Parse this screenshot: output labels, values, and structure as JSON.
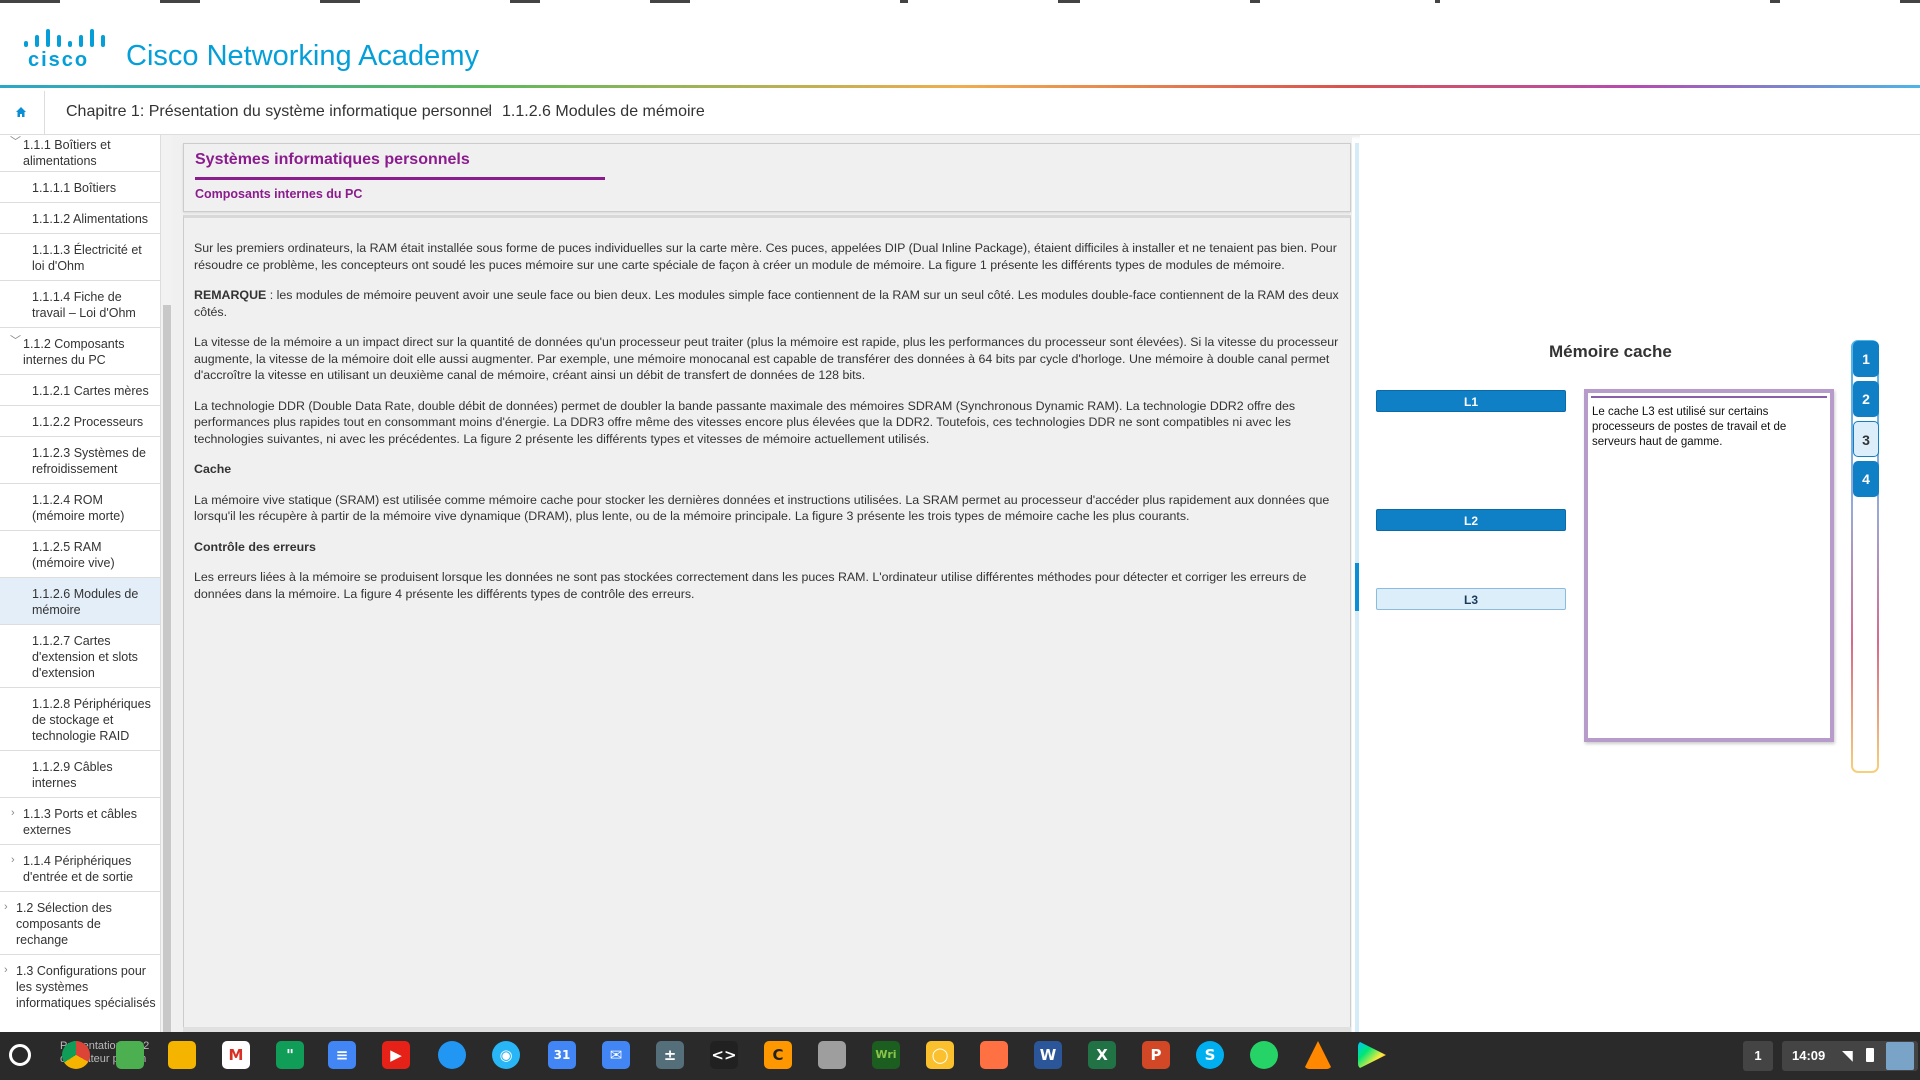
{
  "header": {
    "logo_text": "cisco",
    "brand": "Cisco Networking Academy"
  },
  "breadcrumb": {
    "chapter": "Chapitre 1: Présentation du système informatique personnel",
    "separator": "›",
    "current": "1.1.2.6 Modules de mémoire"
  },
  "sidebar": {
    "items": [
      {
        "label": "1.1.1 Boîtiers et alimentations",
        "chevron": "﹀"
      },
      {
        "label": "1.1.1.1 Boîtiers"
      },
      {
        "label": "1.1.1.2 Alimentations"
      },
      {
        "label": "1.1.1.3 Électricité et loi d'Ohm"
      },
      {
        "label": "1.1.1.4 Fiche de travail – Loi d'Ohm"
      },
      {
        "label": "1.1.2 Composants internes du PC",
        "chevron": "﹀"
      },
      {
        "label": "1.1.2.1 Cartes mères"
      },
      {
        "label": "1.1.2.2 Processeurs"
      },
      {
        "label": "1.1.2.3 Systèmes de refroidissement"
      },
      {
        "label": "1.1.2.4 ROM (mémoire morte)"
      },
      {
        "label": "1.1.2.5 RAM (mémoire vive)"
      },
      {
        "label": "1.1.2.6 Modules de mémoire",
        "active": true
      },
      {
        "label": "1.1.2.7 Cartes d'extension et slots d'extension"
      },
      {
        "label": "1.1.2.8 Périphériques de stockage et technologie RAID"
      },
      {
        "label": "1.1.2.9 Câbles internes"
      },
      {
        "label": "1.1.3 Ports et câbles externes",
        "chevron": "›"
      },
      {
        "label": "1.1.4 Périphériques d'entrée et de sortie",
        "chevron": "›"
      },
      {
        "label": "1.2 Sélection des composants de rechange",
        "chevron": "›"
      },
      {
        "label": "1.3 Configurations pour les systèmes informatiques spécialisés",
        "chevron": "›"
      }
    ]
  },
  "main": {
    "title": "Systèmes informatiques personnels",
    "subtitle": "Composants internes du PC",
    "p1": "Sur les premiers ordinateurs, la RAM était installée sous forme de puces individuelles sur la carte mère. Ces puces, appelées DIP (Dual Inline Package), étaient difficiles à installer et ne tenaient pas bien. Pour résoudre ce problème, les concepteurs ont soudé les puces mémoire sur une carte spéciale de façon à créer un module de mémoire. La figure 1 présente les différents types de modules de mémoire.",
    "remarque_label": "REMARQUE",
    "remarque_text": " : les modules de mémoire peuvent avoir une seule face ou bien deux. Les modules simple face contiennent de la RAM sur un seul côté. Les modules double-face contiennent de la RAM des deux côtés.",
    "p3": "La vitesse de la mémoire a un impact direct sur la quantité de données qu'un processeur peut traiter (plus la mémoire est rapide, plus les performances du processeur sont élevées). Si la vitesse du processeur augmente, la vitesse de la mémoire doit elle aussi augmenter. Par exemple, une mémoire monocanal est capable de transférer des données à 64 bits par cycle d'horloge. Une mémoire à double canal permet d'accroître la vitesse en utilisant un deuxième canal de mémoire, créant ainsi un débit de transfert de données de 128 bits.",
    "p4": "La technologie DDR (Double Data Rate, double débit de données) permet de doubler la bande passante maximale des mémoires SDRAM (Synchronous Dynamic RAM). La technologie DDR2 offre des performances plus rapides tout en consommant moins d'énergie. La DDR3 offre même des vitesses encore plus élevées que la DDR2. Toutefois, ces technologies DDR ne sont compatibles ni avec les technologies suivantes, ni avec les précédentes. La figure 2 présente les différents types et vitesses de mémoire actuellement utilisés.",
    "h_cache": "Cache",
    "p5": "La mémoire vive statique (SRAM) est utilisée comme mémoire cache pour stocker les dernières données et instructions utilisées. La SRAM permet au processeur d'accéder plus rapidement aux données que lorsqu'il les récupère à partir de la mémoire vive dynamique (DRAM), plus lente, ou de la mémoire principale. La figure 3 présente les trois types de mémoire cache les plus courants.",
    "h_errors": "Contrôle des erreurs",
    "p6": "Les erreurs liées à la mémoire se produisent lorsque les données ne sont pas stockées correctement dans les puces RAM. L'ordinateur utilise différentes méthodes pour détecter et corriger les erreurs de données dans la mémoire. La figure 4 présente les différents types de contrôle des erreurs."
  },
  "media": {
    "title": "Mémoire cache",
    "buttons": {
      "l1": "L1",
      "l2": "L2",
      "l3": "L3"
    },
    "info": "Le cache L3 est utilisé sur certains processeurs de postes de travail et de serveurs haut de gamme.",
    "figures": [
      "1",
      "2",
      "3",
      "4"
    ],
    "selected_figure": "3"
  },
  "taskbar": {
    "ghost_line1": "Présentation 1.1.2",
    "ghost_line2": "ordinateur person",
    "calendar_day": "31",
    "window_count": "1",
    "time": "14:09",
    "icons": [
      "chrome-icon",
      "maps-icon",
      "drive-icon",
      "gmail-icon",
      "hangouts-icon",
      "docs-icon",
      "youtube-icon",
      "files-icon",
      "camera-icon",
      "calendar-icon",
      "inbox-icon",
      "calculator-icon",
      "terminal-icon",
      "c-app-icon",
      "chrome-app-icon",
      "writer-icon",
      "keep-icon",
      "slides-icon",
      "word-icon",
      "excel-icon",
      "powerpoint-icon",
      "skype-icon",
      "whatsapp-icon",
      "vlc-icon",
      "play-store-icon"
    ]
  }
}
